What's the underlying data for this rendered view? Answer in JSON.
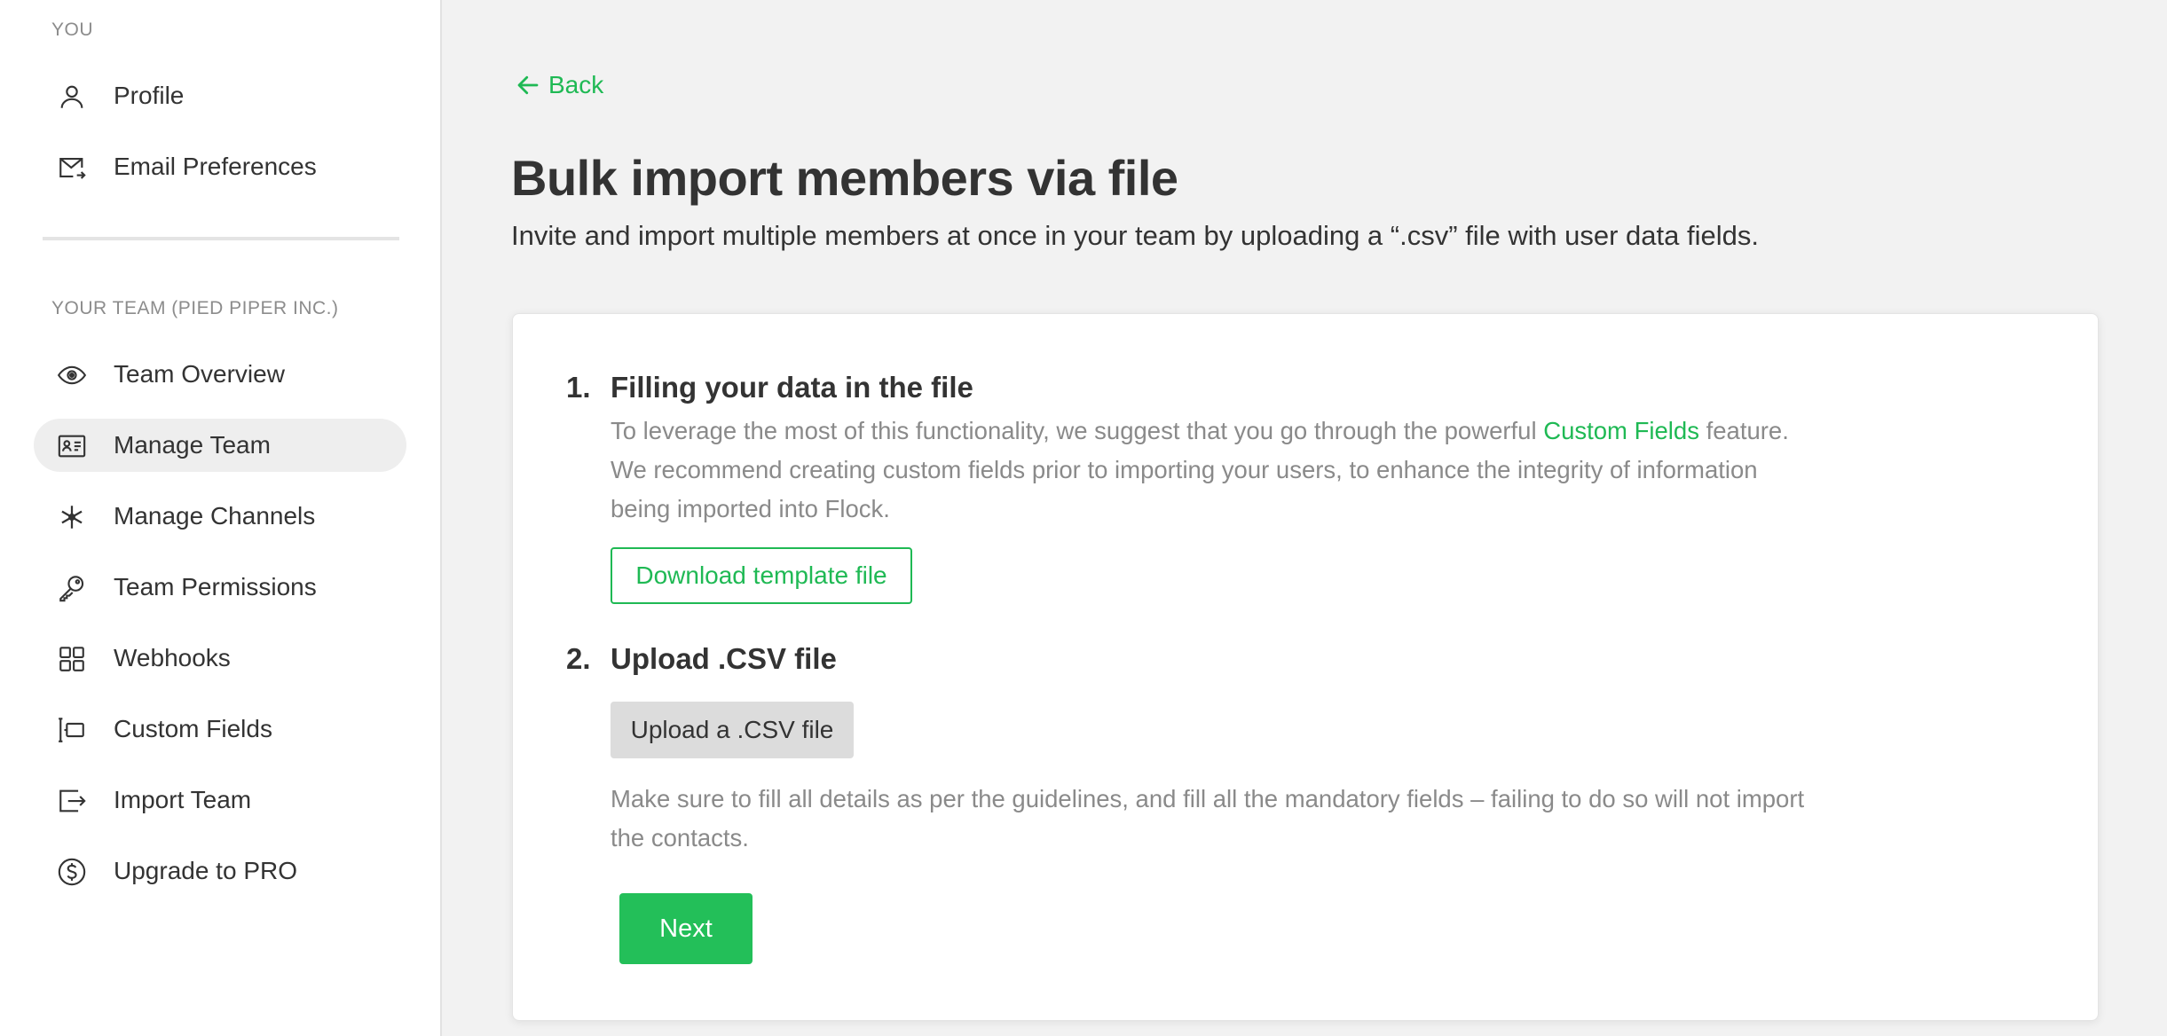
{
  "sidebar": {
    "you_label": "YOU",
    "you_items": [
      {
        "label": "Profile",
        "icon": "user-icon"
      },
      {
        "label": "Email Preferences",
        "icon": "email-icon"
      }
    ],
    "team_label": "YOUR TEAM (PIED PIPER INC.)",
    "team_items": [
      {
        "label": "Team Overview",
        "icon": "eye-icon"
      },
      {
        "label": "Manage Team",
        "icon": "id-card-icon",
        "active": true
      },
      {
        "label": "Manage Channels",
        "icon": "asterisk-icon"
      },
      {
        "label": "Team Permissions",
        "icon": "key-icon"
      },
      {
        "label": "Webhooks",
        "icon": "grid-icon"
      },
      {
        "label": "Custom Fields",
        "icon": "custom-fields-icon"
      },
      {
        "label": "Import Team",
        "icon": "import-icon"
      },
      {
        "label": "Upgrade to PRO",
        "icon": "dollar-icon"
      }
    ]
  },
  "main": {
    "back_label": "Back",
    "title": "Bulk import members via file",
    "subtitle": "Invite and import multiple members at once in your team by uploading a “.csv” file with user data fields.",
    "steps": [
      {
        "number": "1.",
        "title": "Filling your data in the file",
        "desc_before": "To leverage the most of this functionality, we suggest that you go through the powerful ",
        "desc_link": "Custom Fields",
        "desc_after": " feature. We recommend creating custom fields prior to importing your users, to enhance the integrity of information being imported into Flock.",
        "button": "Download template file"
      },
      {
        "number": "2.",
        "title": "Upload .CSV file",
        "button": "Upload a .CSV file",
        "note": "Make sure to fill all details as per the guidelines, and fill all the mandatory fields – failing to do so will not import the contacts."
      }
    ],
    "next_label": "Next"
  },
  "colors": {
    "accent": "#1fb954",
    "primary_button": "#23bf59",
    "background": "#f2f2f2",
    "active_nav": "#eeeeee"
  }
}
